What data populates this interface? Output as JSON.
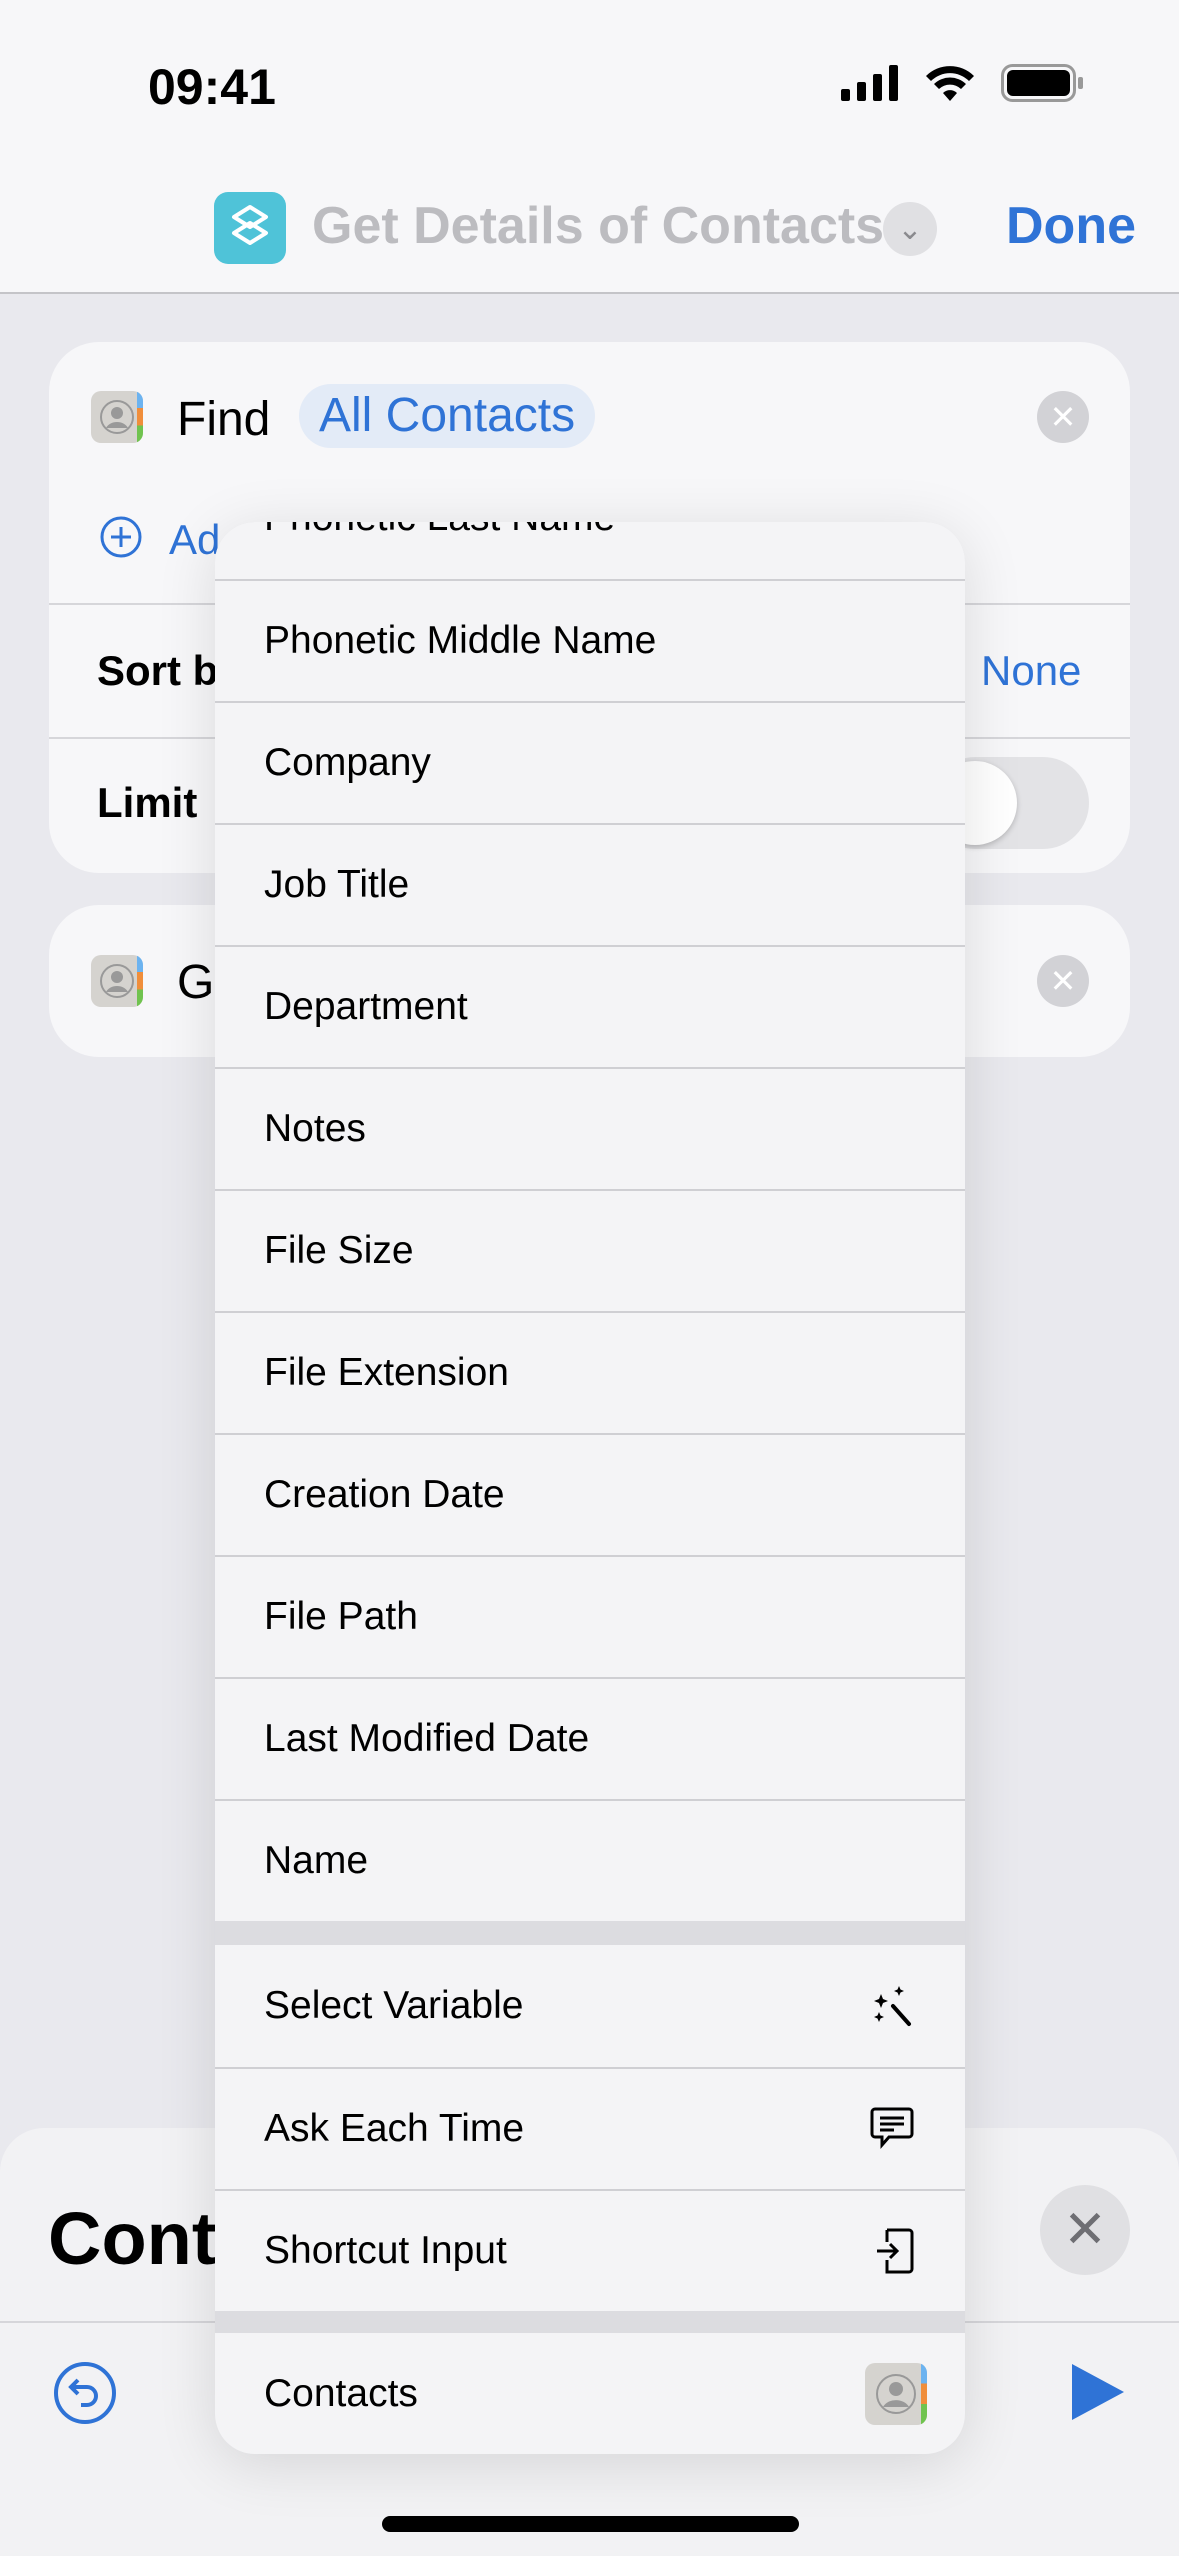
{
  "status_bar": {
    "time": "09:41"
  },
  "nav": {
    "title": "Get Details of Contacts",
    "done_label": "Done"
  },
  "find_card": {
    "find_label": "Find",
    "filter_token": "All Contacts",
    "add_filter_label": "Ad",
    "sort_label": "Sort b",
    "sort_value": "None",
    "limit_label": "Limit",
    "limit_enabled": false
  },
  "details_card": {
    "label": "G"
  },
  "menu": {
    "partial_item": "Phonetic Last Name",
    "items": [
      "Phonetic Middle Name",
      "Company",
      "Job Title",
      "Department",
      "Notes",
      "File Size",
      "File Extension",
      "Creation Date",
      "File Path",
      "Last Modified Date",
      "Name"
    ],
    "variable_items": [
      {
        "label": "Select Variable",
        "icon": "magic-wand-icon"
      },
      {
        "label": "Ask Each Time",
        "icon": "speech-bubble-icon"
      },
      {
        "label": "Shortcut Input",
        "icon": "shortcut-input-icon"
      }
    ],
    "contacts_item": {
      "label": "Contacts",
      "icon": "contacts-app-icon"
    }
  },
  "bottom_sheet": {
    "title": "Cont"
  },
  "colors": {
    "accent": "#2f73d6",
    "app_icon": "#4fc3d8"
  }
}
